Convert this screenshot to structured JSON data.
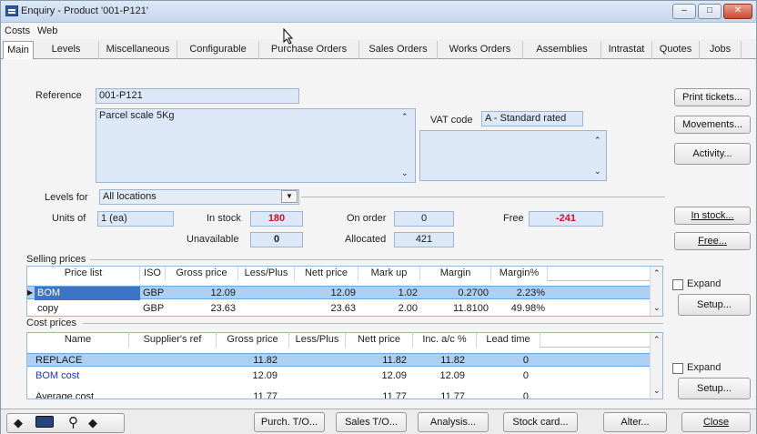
{
  "window": {
    "title": "Enquiry - Product '001-P121'",
    "min": "–",
    "max": "□",
    "close": "✕"
  },
  "menu": [
    "Costs",
    "Web"
  ],
  "tabs": [
    "Main",
    "Levels",
    "Miscellaneous",
    "Configurable",
    "Purchase Orders",
    "Sales Orders",
    "Works Orders",
    "Assemblies",
    "Intrastat",
    "Quotes",
    "Jobs"
  ],
  "main": {
    "reference_label": "Reference",
    "reference": "001-P121",
    "description": "Parcel scale 5Kg",
    "vat_label": "VAT code",
    "vat_code": "A - Standard rated",
    "levels_for_label": "Levels for",
    "levels_for": "All locations",
    "units_of_label": "Units of",
    "units_of": "1 (ea)",
    "in_stock_label": "In stock",
    "in_stock": "180",
    "on_order_label": "On order",
    "on_order": "0",
    "free_label": "Free",
    "free": "-241",
    "unavailable_label": "Unavailable",
    "unavailable": "0",
    "allocated_label": "Allocated",
    "allocated": "421"
  },
  "side_buttons": {
    "print_tickets": "Print tickets...",
    "movements": "Movements...",
    "activity": "Activity...",
    "in_stock": "In stock...",
    "free": "Free..."
  },
  "selling": {
    "title": "Selling prices",
    "headers": [
      "Price list",
      "ISO",
      "Gross price",
      "Less/Plus",
      "Nett price",
      "Mark up",
      "Margin",
      "Margin%"
    ],
    "rows": [
      [
        "BOM",
        "GBP",
        "12.09",
        "",
        "12.09",
        "1.02",
        "0.2700",
        "2.23%"
      ],
      [
        "copy",
        "GBP",
        "23.63",
        "",
        "23.63",
        "2.00",
        "11.8100",
        "49.98%"
      ]
    ],
    "expand_label": "Expand",
    "setup": "Setup..."
  },
  "cost": {
    "title": "Cost prices",
    "headers": [
      "Name",
      "Supplier's ref",
      "Gross price",
      "Less/Plus",
      "Nett price",
      "Inc. a/c %",
      "Lead time"
    ],
    "rows": [
      [
        "REPLACE",
        "",
        "11.82",
        "",
        "11.82",
        "11.82",
        "0"
      ],
      [
        "BOM cost",
        "",
        "12.09",
        "",
        "12.09",
        "12.09",
        "0"
      ],
      [
        "Average cost",
        "",
        "11.77",
        "",
        "11.77",
        "11.77",
        "0"
      ]
    ],
    "expand_label": "Expand",
    "setup": "Setup..."
  },
  "toolbar": {
    "purch": "Purch. T/O...",
    "sales": "Sales T/O...",
    "analysis": "Analysis...",
    "stock_card": "Stock card...",
    "alter": "Alter...",
    "close": "Close"
  }
}
